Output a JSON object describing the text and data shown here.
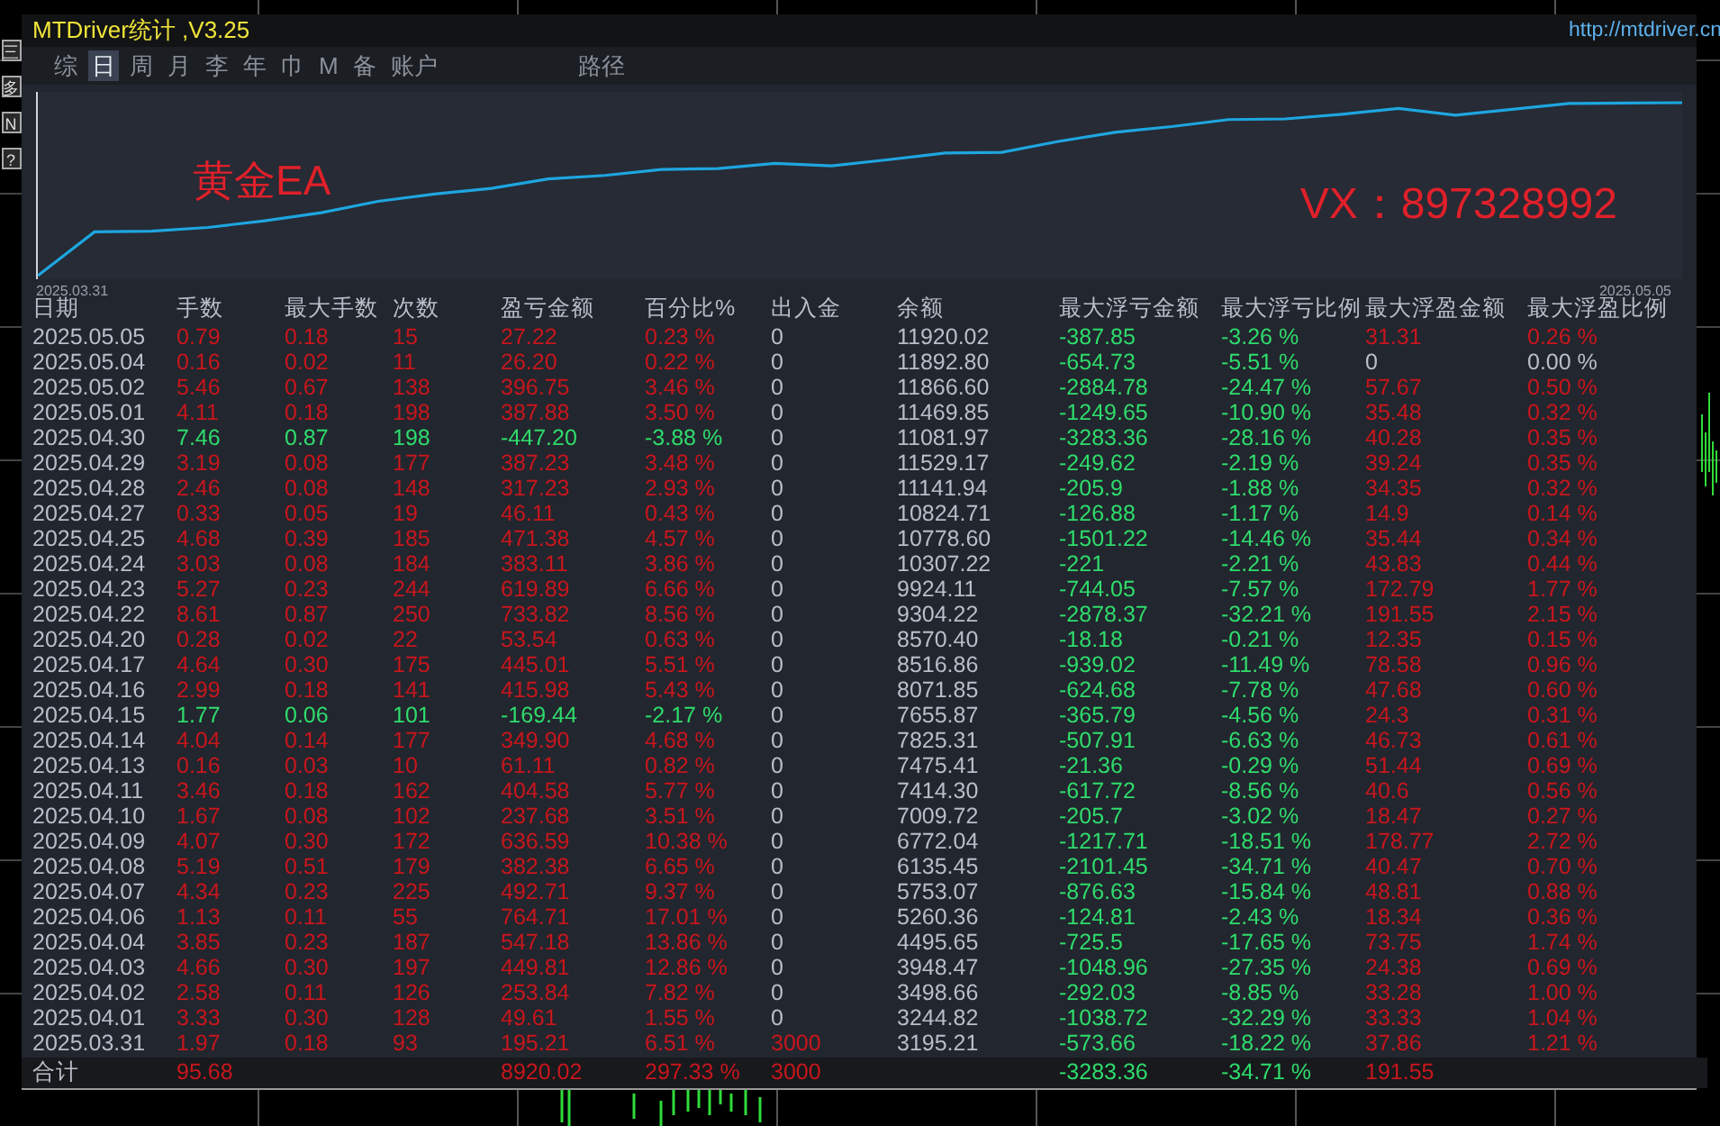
{
  "left_toolbar": [
    "三",
    "多",
    "N",
    "?"
  ],
  "window": {
    "title": "MTDriver统计 ,V3.25",
    "link": "http://mtdriver.cn"
  },
  "tabs": [
    {
      "label": "综",
      "selected": false
    },
    {
      "label": "日",
      "selected": true
    },
    {
      "label": "周",
      "selected": false
    },
    {
      "label": "月",
      "selected": false
    },
    {
      "label": "李",
      "selected": false
    },
    {
      "label": "年",
      "selected": false
    },
    {
      "label": "巾",
      "selected": false
    },
    {
      "label": "M",
      "selected": false
    },
    {
      "label": "备",
      "selected": false
    },
    {
      "label": "账户",
      "selected": false
    }
  ],
  "path_button": "路径",
  "chart": {
    "caption": "黄金EA",
    "contact": "VX：897328992",
    "x_start": "2025.03.31",
    "x_end": "2025.05.05"
  },
  "table": {
    "columns": [
      "日期",
      "手数",
      "最大手数",
      "次数",
      "盈亏金额",
      "百分比%",
      "出入金",
      "余额",
      "最大浮亏金额",
      "最大浮亏比例",
      "最大浮盈金额",
      "最大浮盈比例"
    ],
    "rows": [
      {
        "loss": false,
        "deposit_flagged": false,
        "float_profit": true,
        "cells": [
          "2025.05.05",
          "0.79",
          "0.18",
          "15",
          "27.22",
          "0.23 %",
          "0",
          "11920.02",
          "-387.85",
          "-3.26 %",
          "31.31",
          "0.26 %"
        ]
      },
      {
        "loss": false,
        "deposit_flagged": false,
        "float_profit": false,
        "cells": [
          "2025.05.04",
          "0.16",
          "0.02",
          "11",
          "26.20",
          "0.22 %",
          "0",
          "11892.80",
          "-654.73",
          "-5.51 %",
          "0",
          "0.00 %"
        ]
      },
      {
        "loss": false,
        "deposit_flagged": false,
        "float_profit": true,
        "cells": [
          "2025.05.02",
          "5.46",
          "0.67",
          "138",
          "396.75",
          "3.46 %",
          "0",
          "11866.60",
          "-2884.78",
          "-24.47 %",
          "57.67",
          "0.50 %"
        ]
      },
      {
        "loss": false,
        "deposit_flagged": false,
        "float_profit": true,
        "cells": [
          "2025.05.01",
          "4.11",
          "0.18",
          "198",
          "387.88",
          "3.50 %",
          "0",
          "11469.85",
          "-1249.65",
          "-10.90 %",
          "35.48",
          "0.32 %"
        ]
      },
      {
        "loss": true,
        "deposit_flagged": false,
        "float_profit": true,
        "cells": [
          "2025.04.30",
          "7.46",
          "0.87",
          "198",
          "-447.20",
          "-3.88 %",
          "0",
          "11081.97",
          "-3283.36",
          "-28.16 %",
          "40.28",
          "0.35 %"
        ]
      },
      {
        "loss": false,
        "deposit_flagged": false,
        "float_profit": true,
        "cells": [
          "2025.04.29",
          "3.19",
          "0.08",
          "177",
          "387.23",
          "3.48 %",
          "0",
          "11529.17",
          "-249.62",
          "-2.19 %",
          "39.24",
          "0.35 %"
        ]
      },
      {
        "loss": false,
        "deposit_flagged": false,
        "float_profit": true,
        "cells": [
          "2025.04.28",
          "2.46",
          "0.08",
          "148",
          "317.23",
          "2.93 %",
          "0",
          "11141.94",
          "-205.9",
          "-1.88 %",
          "34.35",
          "0.32 %"
        ]
      },
      {
        "loss": false,
        "deposit_flagged": false,
        "float_profit": true,
        "cells": [
          "2025.04.27",
          "0.33",
          "0.05",
          "19",
          "46.11",
          "0.43 %",
          "0",
          "10824.71",
          "-126.88",
          "-1.17 %",
          "14.9",
          "0.14 %"
        ]
      },
      {
        "loss": false,
        "deposit_flagged": false,
        "float_profit": true,
        "cells": [
          "2025.04.25",
          "4.68",
          "0.39",
          "185",
          "471.38",
          "4.57 %",
          "0",
          "10778.60",
          "-1501.22",
          "-14.46 %",
          "35.44",
          "0.34 %"
        ]
      },
      {
        "loss": false,
        "deposit_flagged": false,
        "float_profit": true,
        "cells": [
          "2025.04.24",
          "3.03",
          "0.08",
          "184",
          "383.11",
          "3.86 %",
          "0",
          "10307.22",
          "-221",
          "-2.21 %",
          "43.83",
          "0.44 %"
        ]
      },
      {
        "loss": false,
        "deposit_flagged": false,
        "float_profit": true,
        "cells": [
          "2025.04.23",
          "5.27",
          "0.23",
          "244",
          "619.89",
          "6.66 %",
          "0",
          "9924.11",
          "-744.05",
          "-7.57 %",
          "172.79",
          "1.77 %"
        ]
      },
      {
        "loss": false,
        "deposit_flagged": false,
        "float_profit": true,
        "cells": [
          "2025.04.22",
          "8.61",
          "0.87",
          "250",
          "733.82",
          "8.56 %",
          "0",
          "9304.22",
          "-2878.37",
          "-32.21 %",
          "191.55",
          "2.15 %"
        ]
      },
      {
        "loss": false,
        "deposit_flagged": false,
        "float_profit": true,
        "cells": [
          "2025.04.20",
          "0.28",
          "0.02",
          "22",
          "53.54",
          "0.63 %",
          "0",
          "8570.40",
          "-18.18",
          "-0.21 %",
          "12.35",
          "0.15 %"
        ]
      },
      {
        "loss": false,
        "deposit_flagged": false,
        "float_profit": true,
        "cells": [
          "2025.04.17",
          "4.64",
          "0.30",
          "175",
          "445.01",
          "5.51 %",
          "0",
          "8516.86",
          "-939.02",
          "-11.49 %",
          "78.58",
          "0.96 %"
        ]
      },
      {
        "loss": false,
        "deposit_flagged": false,
        "float_profit": true,
        "cells": [
          "2025.04.16",
          "2.99",
          "0.18",
          "141",
          "415.98",
          "5.43 %",
          "0",
          "8071.85",
          "-624.68",
          "-7.78 %",
          "47.68",
          "0.60 %"
        ]
      },
      {
        "loss": true,
        "deposit_flagged": false,
        "float_profit": true,
        "cells": [
          "2025.04.15",
          "1.77",
          "0.06",
          "101",
          "-169.44",
          "-2.17 %",
          "0",
          "7655.87",
          "-365.79",
          "-4.56 %",
          "24.3",
          "0.31 %"
        ]
      },
      {
        "loss": false,
        "deposit_flagged": false,
        "float_profit": true,
        "cells": [
          "2025.04.14",
          "4.04",
          "0.14",
          "177",
          "349.90",
          "4.68 %",
          "0",
          "7825.31",
          "-507.91",
          "-6.63 %",
          "46.73",
          "0.61 %"
        ]
      },
      {
        "loss": false,
        "deposit_flagged": false,
        "float_profit": true,
        "cells": [
          "2025.04.13",
          "0.16",
          "0.03",
          "10",
          "61.11",
          "0.82 %",
          "0",
          "7475.41",
          "-21.36",
          "-0.29 %",
          "51.44",
          "0.69 %"
        ]
      },
      {
        "loss": false,
        "deposit_flagged": false,
        "float_profit": true,
        "cells": [
          "2025.04.11",
          "3.46",
          "0.18",
          "162",
          "404.58",
          "5.77 %",
          "0",
          "7414.30",
          "-617.72",
          "-8.56 %",
          "40.6",
          "0.56 %"
        ]
      },
      {
        "loss": false,
        "deposit_flagged": false,
        "float_profit": true,
        "cells": [
          "2025.04.10",
          "1.67",
          "0.08",
          "102",
          "237.68",
          "3.51 %",
          "0",
          "7009.72",
          "-205.7",
          "-3.02 %",
          "18.47",
          "0.27 %"
        ]
      },
      {
        "loss": false,
        "deposit_flagged": false,
        "float_profit": true,
        "cells": [
          "2025.04.09",
          "4.07",
          "0.30",
          "172",
          "636.59",
          "10.38 %",
          "0",
          "6772.04",
          "-1217.71",
          "-18.51 %",
          "178.77",
          "2.72 %"
        ]
      },
      {
        "loss": false,
        "deposit_flagged": false,
        "float_profit": true,
        "cells": [
          "2025.04.08",
          "5.19",
          "0.51",
          "179",
          "382.38",
          "6.65 %",
          "0",
          "6135.45",
          "-2101.45",
          "-34.71 %",
          "40.47",
          "0.70 %"
        ]
      },
      {
        "loss": false,
        "deposit_flagged": false,
        "float_profit": true,
        "cells": [
          "2025.04.07",
          "4.34",
          "0.23",
          "225",
          "492.71",
          "9.37 %",
          "0",
          "5753.07",
          "-876.63",
          "-15.84 %",
          "48.81",
          "0.88 %"
        ]
      },
      {
        "loss": false,
        "deposit_flagged": false,
        "float_profit": true,
        "cells": [
          "2025.04.06",
          "1.13",
          "0.11",
          "55",
          "764.71",
          "17.01 %",
          "0",
          "5260.36",
          "-124.81",
          "-2.43 %",
          "18.34",
          "0.36 %"
        ]
      },
      {
        "loss": false,
        "deposit_flagged": false,
        "float_profit": true,
        "cells": [
          "2025.04.04",
          "3.85",
          "0.23",
          "187",
          "547.18",
          "13.86 %",
          "0",
          "4495.65",
          "-725.5",
          "-17.65 %",
          "73.75",
          "1.74 %"
        ]
      },
      {
        "loss": false,
        "deposit_flagged": false,
        "float_profit": true,
        "cells": [
          "2025.04.03",
          "4.66",
          "0.30",
          "197",
          "449.81",
          "12.86 %",
          "0",
          "3948.47",
          "-1048.96",
          "-27.35 %",
          "24.38",
          "0.69 %"
        ]
      },
      {
        "loss": false,
        "deposit_flagged": false,
        "float_profit": true,
        "cells": [
          "2025.04.02",
          "2.58",
          "0.11",
          "126",
          "253.84",
          "7.82 %",
          "0",
          "3498.66",
          "-292.03",
          "-8.85 %",
          "33.28",
          "1.00 %"
        ]
      },
      {
        "loss": false,
        "deposit_flagged": false,
        "float_profit": true,
        "cells": [
          "2025.04.01",
          "3.33",
          "0.30",
          "128",
          "49.61",
          "1.55 %",
          "0",
          "3244.82",
          "-1038.72",
          "-32.29 %",
          "33.33",
          "1.04 %"
        ]
      },
      {
        "loss": false,
        "deposit_flagged": true,
        "float_profit": true,
        "cells": [
          "2025.03.31",
          "1.97",
          "0.18",
          "93",
          "195.21",
          "6.51 %",
          "3000",
          "3195.21",
          "-573.66",
          "-18.22 %",
          "37.86",
          "1.21 %"
        ]
      }
    ],
    "total": {
      "cells": [
        "合计",
        "95.68",
        null,
        null,
        "8920.02",
        "297.33 %",
        "3000",
        null,
        "-3283.36",
        "-34.71 %",
        "191.55"
      ]
    }
  }
}
